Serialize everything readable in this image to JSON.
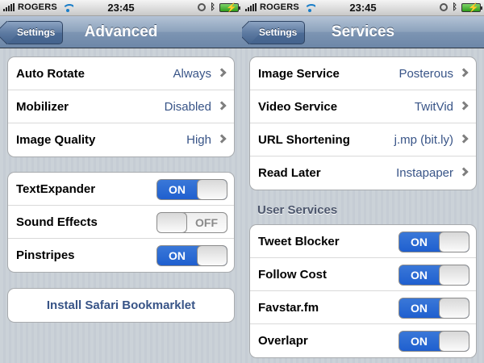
{
  "status": {
    "carrier": "ROGERS",
    "time": "23:45"
  },
  "left": {
    "back_label": "Settings",
    "title": "Advanced",
    "detail_rows": [
      {
        "label": "Auto Rotate",
        "value": "Always"
      },
      {
        "label": "Mobilizer",
        "value": "Disabled"
      },
      {
        "label": "Image Quality",
        "value": "High"
      }
    ],
    "toggle_rows": [
      {
        "label": "TextExpander",
        "state": "ON"
      },
      {
        "label": "Sound Effects",
        "state": "OFF"
      },
      {
        "label": "Pinstripes",
        "state": "ON"
      }
    ],
    "bookmarklet_label": "Install Safari Bookmarklet"
  },
  "right": {
    "back_label": "Settings",
    "title": "Services",
    "detail_rows": [
      {
        "label": "Image Service",
        "value": "Posterous"
      },
      {
        "label": "Video Service",
        "value": "TwitVid"
      },
      {
        "label": "URL Shortening",
        "value": "j.mp (bit.ly)"
      },
      {
        "label": "Read Later",
        "value": "Instapaper"
      }
    ],
    "section_header": "User Services",
    "toggle_rows": [
      {
        "label": "Tweet Blocker",
        "state": "ON"
      },
      {
        "label": "Follow Cost",
        "state": "ON"
      },
      {
        "label": "Favstar.fm",
        "state": "ON"
      },
      {
        "label": "Overlapr",
        "state": "ON"
      }
    ]
  },
  "colors": {
    "value_text": "#385487",
    "switch_on": "#1f5fcf",
    "nav_bar": "#6d87a8"
  }
}
